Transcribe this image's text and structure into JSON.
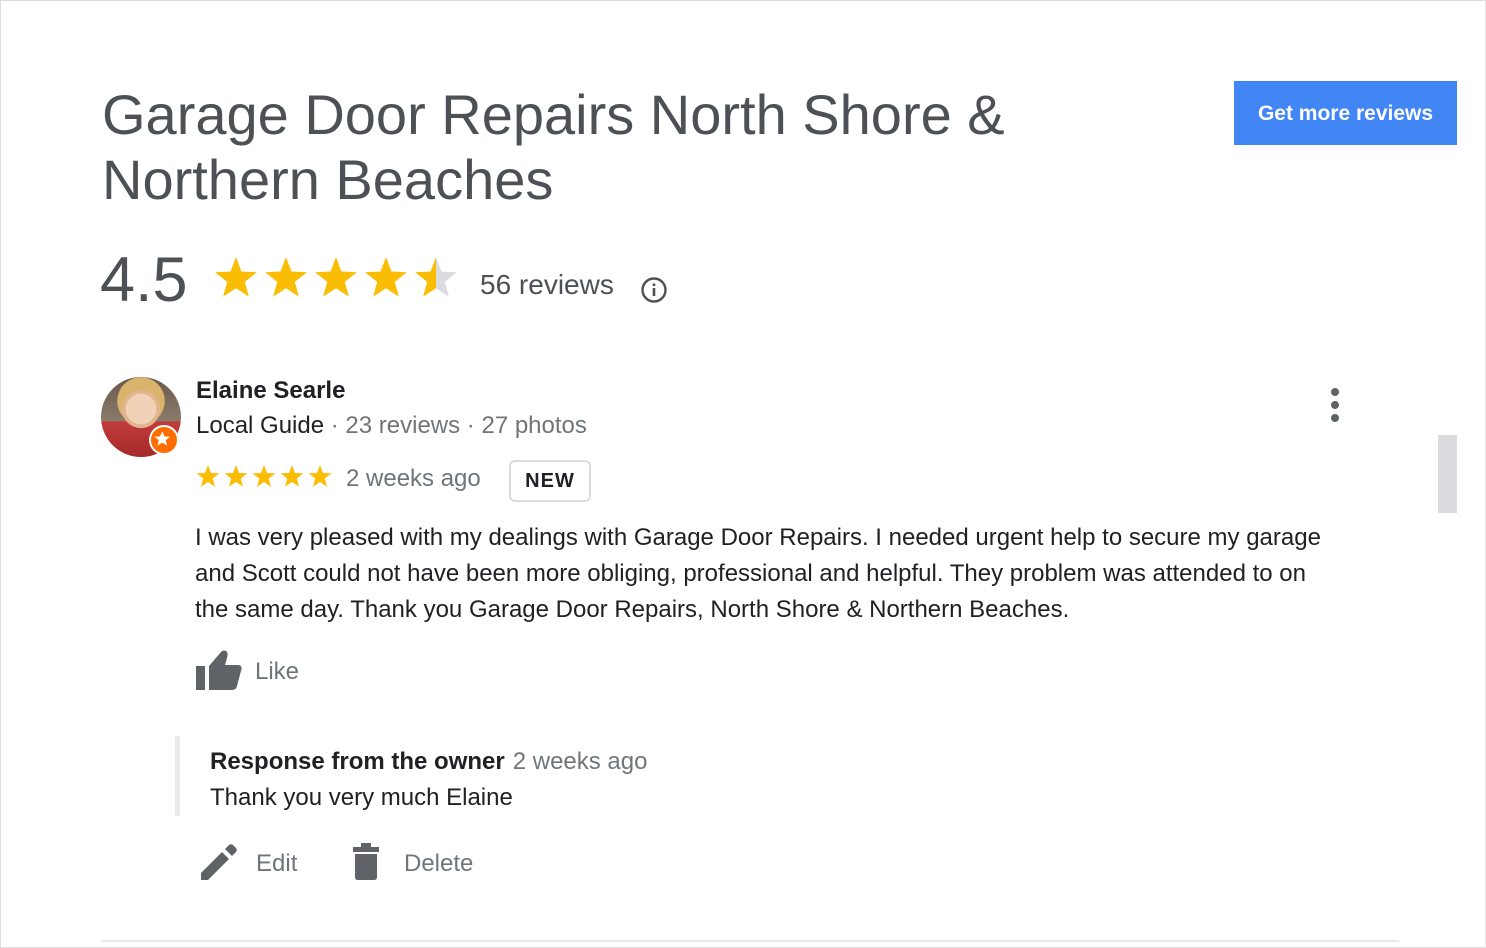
{
  "business": {
    "name": "Garage Door Repairs North Shore & Northern Beaches",
    "rating": "4.5",
    "rating_value": 4.5,
    "rating_max": 5,
    "review_count_label": "56 reviews"
  },
  "actions": {
    "get_more_reviews": "Get more reviews"
  },
  "review": {
    "reviewer_name": "Elaine Searle",
    "reviewer_role": "Local Guide",
    "reviewer_meta": " · 23 reviews · 27 photos",
    "stars": 5,
    "time": "2 weeks ago",
    "badge": "NEW",
    "text": "I was very pleased with my dealings with Garage Door Repairs. I needed urgent help to secure my garage and Scott could not have been more obliging, professional and helpful.  They problem was attended to on the same day. Thank you Garage Door Repairs, North Shore & Northern Beaches.",
    "like_label": "Like"
  },
  "owner_response": {
    "label": "Response from the owner",
    "time": "2 weeks ago",
    "text": "Thank you very much Elaine"
  },
  "response_actions": {
    "edit_label": "Edit",
    "delete_label": "Delete"
  },
  "colors": {
    "star": "#fbbc04",
    "star_empty": "#dadce0",
    "accent": "#4285f4",
    "local_guide_badge": "#ff6d00"
  },
  "icons": {
    "info": "info-icon",
    "more": "more-vert-icon",
    "like": "thumb-up-icon",
    "edit": "pencil-icon",
    "delete": "trash-icon",
    "guide": "star-badge-icon"
  }
}
